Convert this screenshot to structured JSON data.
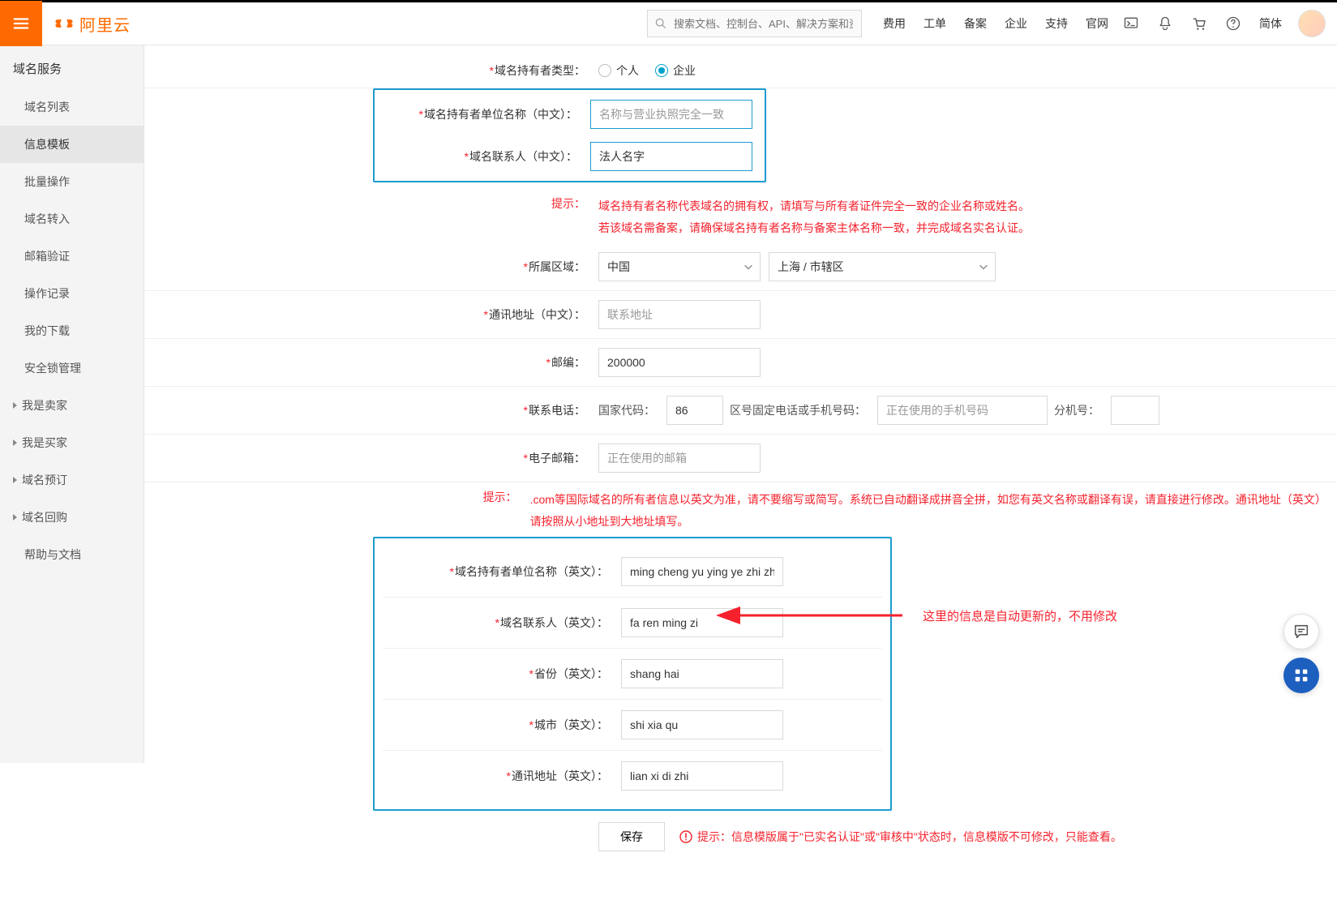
{
  "brand": "阿里云",
  "search_placeholder": "搜索文档、控制台、API、解决方案和资源",
  "topnav": [
    "费用",
    "工单",
    "备案",
    "企业",
    "支持",
    "官网"
  ],
  "lang": "简体",
  "sidebar": {
    "title": "域名服务",
    "items": [
      {
        "label": "域名列表",
        "caret": false
      },
      {
        "label": "信息模板",
        "caret": false,
        "active": true
      },
      {
        "label": "批量操作",
        "caret": false
      },
      {
        "label": "域名转入",
        "caret": false
      },
      {
        "label": "邮箱验证",
        "caret": false
      },
      {
        "label": "操作记录",
        "caret": false
      },
      {
        "label": "我的下载",
        "caret": false
      },
      {
        "label": "安全锁管理",
        "caret": false
      },
      {
        "label": "我是卖家",
        "caret": true
      },
      {
        "label": "我是买家",
        "caret": true
      },
      {
        "label": "域名预订",
        "caret": true
      },
      {
        "label": "域名回购",
        "caret": true
      },
      {
        "label": "帮助与文档",
        "caret": false
      }
    ]
  },
  "form": {
    "holder_type_label": "域名持有者类型：",
    "holder_type_options": {
      "personal": "个人",
      "enterprise": "企业"
    },
    "holder_type_selected": "enterprise",
    "org_name_cn_label": "域名持有者单位名称（中文）：",
    "org_name_cn_placeholder": "名称与营业执照完全一致",
    "contact_cn_label": "域名联系人（中文）：",
    "contact_cn_value": "法人名字",
    "hint1_label": "提示：",
    "hint1_line1": "域名持有者名称代表域名的拥有权，请填写与所有者证件完全一致的企业名称或姓名。",
    "hint1_line2": "若该域名需备案，请确保域名持有者名称与备案主体名称一致，并完成域名实名认证。",
    "region_label": "所属区域：",
    "region_country": "中国",
    "region_city": "上海 / 市辖区",
    "address_cn_label": "通讯地址（中文）：",
    "address_cn_placeholder": "联系地址",
    "postcode_label": "邮编：",
    "postcode_value": "200000",
    "phone_label": "联系电话：",
    "phone_country_code_label": "国家代码：",
    "phone_country_code": "86",
    "phone_area_label": "区号固定电话或手机号码：",
    "phone_main_placeholder": "正在使用的手机号码",
    "phone_ext_label": "分机号：",
    "email_label": "电子邮箱：",
    "email_placeholder": "正在使用的邮箱",
    "hint2_label": "提示：",
    "hint2_text": ".com等国际域名的所有者信息以英文为准，请不要缩写或简写。系统已自动翻译成拼音全拼，如您有英文名称或翻译有误，请直接进行修改。通讯地址（英文）请按照从小地址到大地址填写。",
    "org_name_en_label": "域名持有者单位名称（英文）：",
    "org_name_en_value": "ming cheng yu ying ye zhi zhao w",
    "contact_en_label": "域名联系人（英文）：",
    "contact_en_value": "fa ren ming zi",
    "province_en_label": "省份（英文）：",
    "province_en_value": "shang hai",
    "city_en_label": "城市（英文）：",
    "city_en_value": "shi xia qu",
    "address_en_label": "通讯地址（英文）：",
    "address_en_value": "lian xi di zhi",
    "annotation": "这里的信息是自动更新的，不用修改",
    "save_label": "保存",
    "save_hint": "提示：信息模版属于\"已实名认证\"或\"审核中\"状态时，信息模版不可修改，只能查看。"
  }
}
